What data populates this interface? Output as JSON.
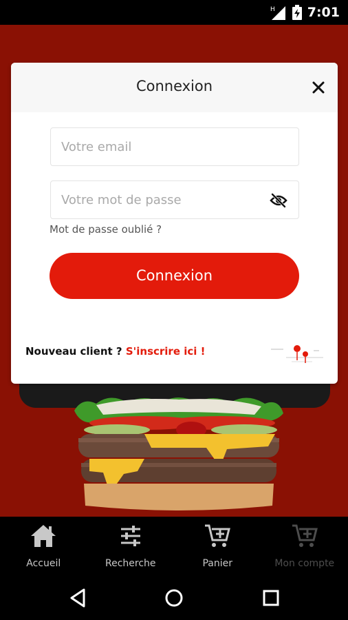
{
  "status_bar": {
    "time": "7:01",
    "icons": [
      "network-icon",
      "signal-icon",
      "battery-charging-icon"
    ]
  },
  "modal": {
    "title": "Connexion",
    "email_placeholder": "Votre email",
    "password_placeholder": "Votre mot de passe",
    "forgot_password": "Mot de passe oublié ?",
    "login_button": "Connexion",
    "new_client_text": "Nouveau client ? ",
    "signup_link": "S'inscrire ici !"
  },
  "bottom_nav": {
    "items": [
      {
        "label": "Accueil",
        "icon": "home-icon"
      },
      {
        "label": "Recherche",
        "icon": "sliders-icon"
      },
      {
        "label": "Panier",
        "icon": "cart-icon"
      },
      {
        "label": "Mon compte",
        "icon": "cart-icon",
        "disabled": true
      }
    ]
  },
  "system_nav": {
    "buttons": [
      "back-icon",
      "home-circle-icon",
      "recents-icon"
    ]
  },
  "colors": {
    "brand_red": "#e31b0b",
    "background": "#8a1104",
    "nav_background": "#000000"
  }
}
